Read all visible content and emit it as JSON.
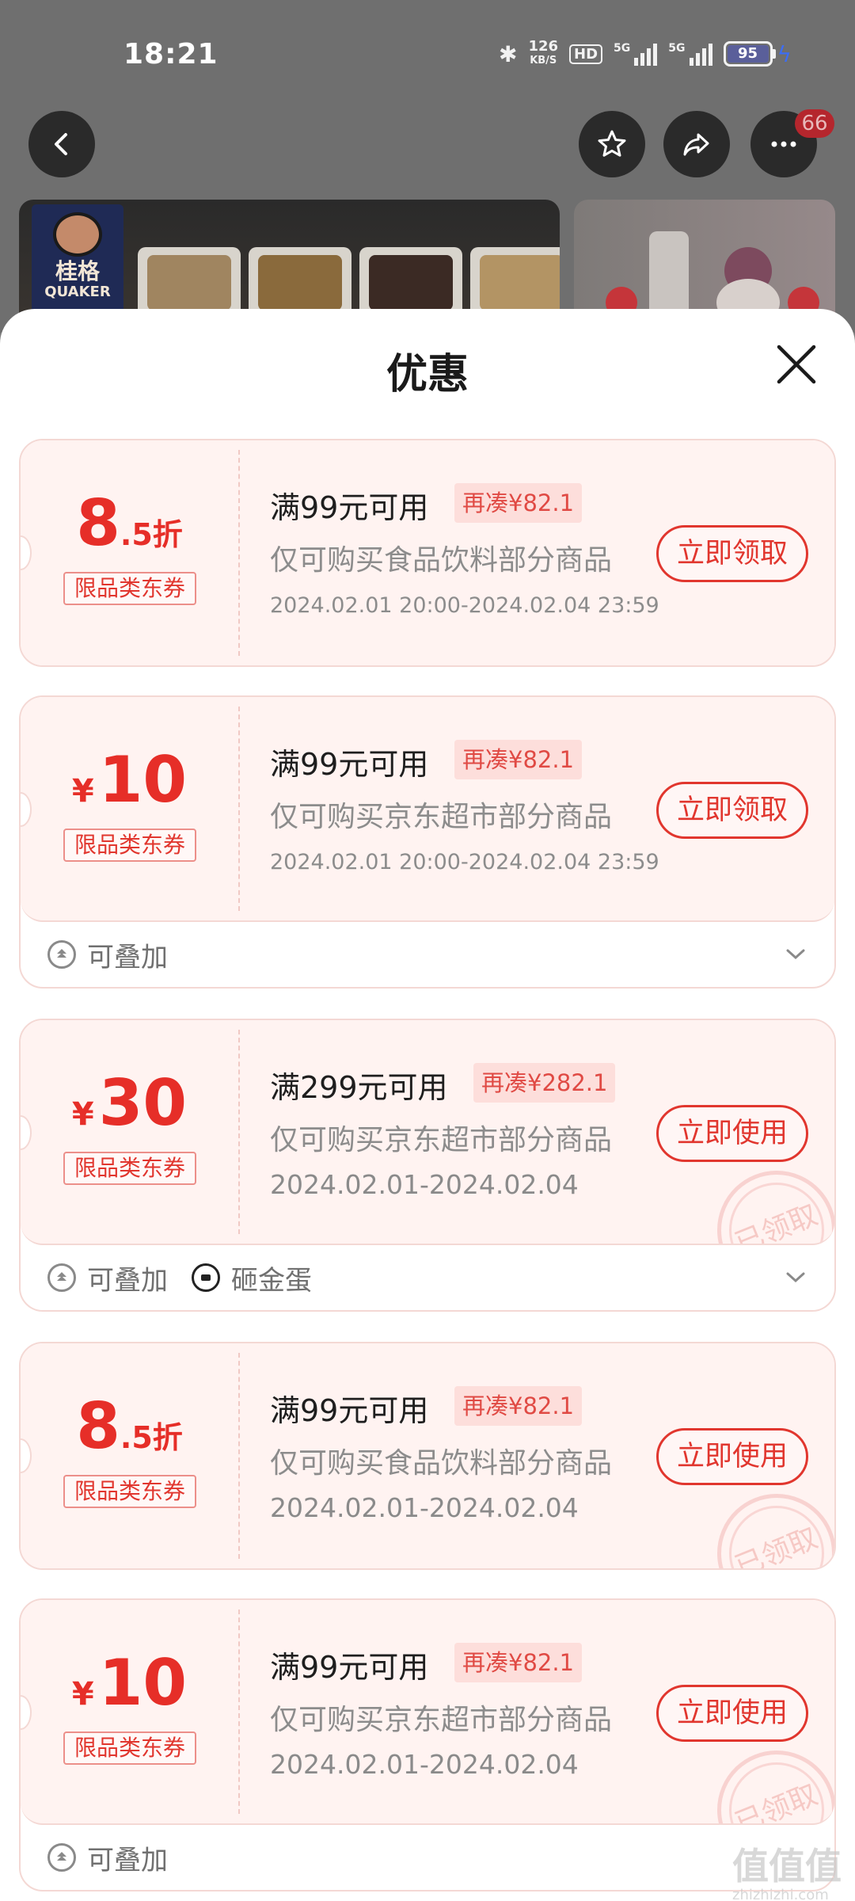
{
  "status_bar": {
    "time": "18:21",
    "net_speed_value": "126",
    "net_speed_unit": "KB/S",
    "hd_label": "HD",
    "sim1_label": "5G",
    "sim2_label": "5G",
    "battery": "95"
  },
  "header": {
    "more_badge": "66"
  },
  "product": {
    "brand_cn": "桂格",
    "brand_en": "QUAKER"
  },
  "sheet": {
    "title": "优惠"
  },
  "coupons": [
    {
      "amount_main": "8",
      "amount_sub": ".5折",
      "tag": "限品类东券",
      "condition": "满99元可用",
      "need": "再凑¥82.1",
      "scope": "仅可购买食品饮料部分商品",
      "date": "2024.02.01 20:00-2024.02.04 23:59",
      "action": "立即领取"
    },
    {
      "currency": "¥",
      "amount_main": "10",
      "tag": "限品类东券",
      "condition": "满99元可用",
      "need": "再凑¥82.1",
      "scope": "仅可购买京东超市部分商品",
      "date": "2024.02.01 20:00-2024.02.04 23:59",
      "action": "立即领取",
      "footer": [
        "可叠加"
      ]
    },
    {
      "currency": "¥",
      "amount_main": "30",
      "tag": "限品类东券",
      "condition": "满299元可用",
      "need": "再凑¥282.1",
      "scope": "仅可购买京东超市部分商品",
      "date": "2024.02.01-2024.02.04",
      "action": "立即使用",
      "stamp": "已领取",
      "footer": [
        "可叠加",
        "砸金蛋"
      ]
    },
    {
      "amount_main": "8",
      "amount_sub": ".5折",
      "tag": "限品类东券",
      "condition": "满99元可用",
      "need": "再凑¥82.1",
      "scope": "仅可购买食品饮料部分商品",
      "date": "2024.02.01-2024.02.04",
      "action": "立即使用",
      "stamp": "已领取"
    },
    {
      "currency": "¥",
      "amount_main": "10",
      "tag": "限品类东券",
      "condition": "满99元可用",
      "need": "再凑¥82.1",
      "scope": "仅可购买京东超市部分商品",
      "date": "2024.02.01-2024.02.04",
      "action": "立即使用",
      "stamp": "已领取",
      "footer": [
        "可叠加"
      ]
    }
  ],
  "watermark": {
    "logo": "值值值",
    "site": "zhizhizhi.com"
  },
  "colors": {
    "accent": "#e1362e",
    "coupon_bg": "#fff3f1",
    "need_bg": "#fddedb"
  }
}
